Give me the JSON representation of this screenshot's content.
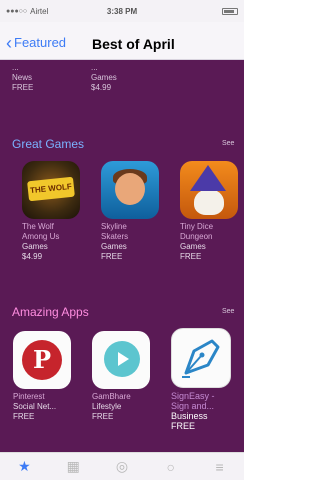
{
  "status_bar": {
    "carrier": "Airtel",
    "time": "3:38 PM"
  },
  "nav": {
    "back_label": "Featured",
    "title": "Best of April"
  },
  "top_row": [
    {
      "name": "...",
      "category": "News",
      "price": "FREE"
    },
    {
      "name": "...",
      "category": "Games",
      "price": "$4.99"
    }
  ],
  "great_games": {
    "title": "Great Games",
    "see_all": "See",
    "items": [
      {
        "name1": "The Wolf",
        "name2": "Among Us",
        "category": "Games",
        "price": "$4.99"
      },
      {
        "name1": "Skyline",
        "name2": "Skaters",
        "category": "Games",
        "price": "FREE"
      },
      {
        "name1": "Tiny Dice",
        "name2": "Dungeon",
        "category": "Games",
        "price": "FREE"
      }
    ]
  },
  "amazing_apps": {
    "title": "Amazing Apps",
    "see_all": "See",
    "items": [
      {
        "name1": "Pinterest",
        "name2": "",
        "category": "Social Net...",
        "price": "FREE"
      },
      {
        "name1": "GamBhare",
        "name2": "",
        "category": "Lifestyle",
        "price": "FREE"
      },
      {
        "name1": "SignEasy -",
        "name2": "Sign and...",
        "category": "Business",
        "price": "FREE"
      }
    ]
  },
  "colors": {
    "section_bg": "#5a1a55",
    "accent": "#3d7bf5",
    "games_title": "#7bb3ff",
    "apps_title": "#ff8de0"
  },
  "tab_icons": [
    "star-icon",
    "grid-icon",
    "compass-icon",
    "search-icon",
    "list-icon"
  ]
}
